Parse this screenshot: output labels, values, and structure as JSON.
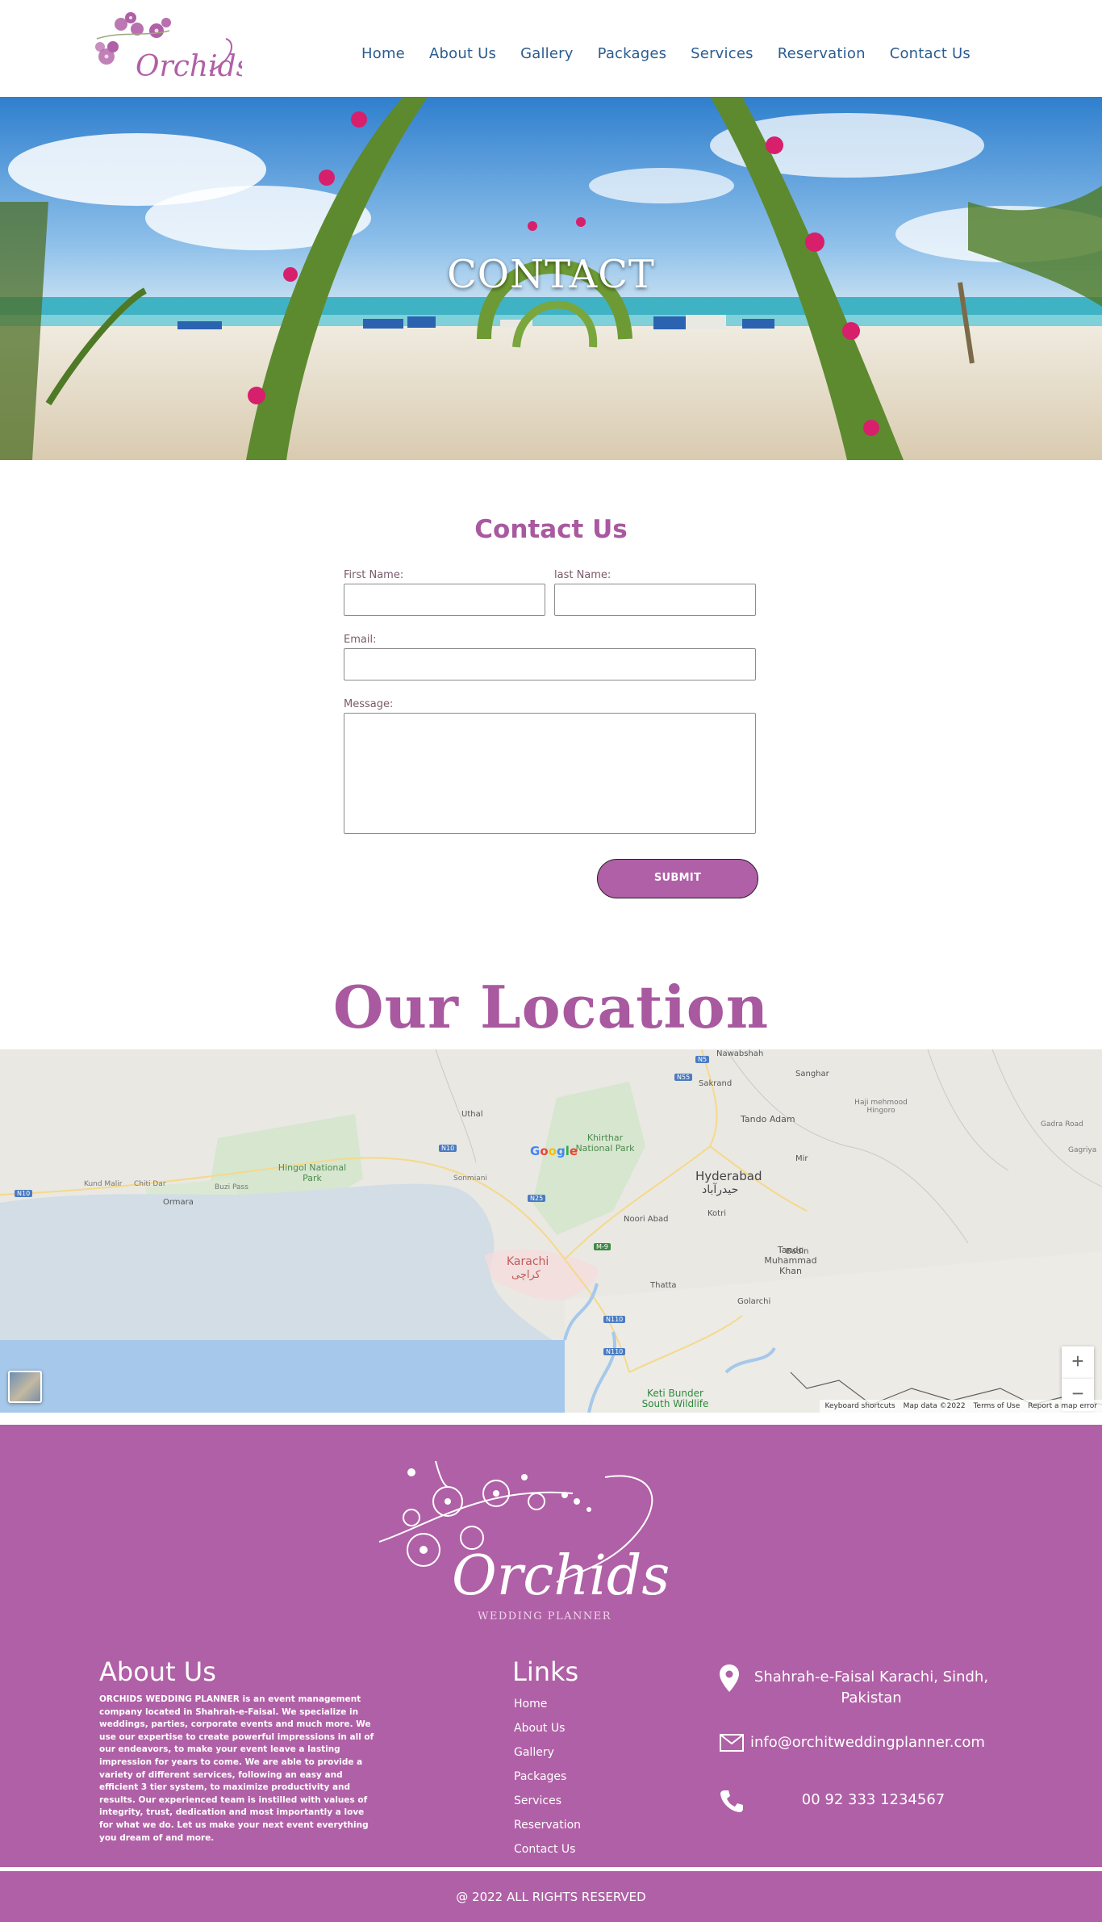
{
  "header": {
    "logo_text": "Orchids",
    "nav": [
      "Home",
      "About Us",
      "Gallery",
      "Packages",
      "Services",
      "Reservation",
      "Contact Us"
    ]
  },
  "hero": {
    "title": "CONTACT"
  },
  "contact_form": {
    "heading": "Contact Us",
    "first_name_label": "First Name:",
    "last_name_label": "last Name:",
    "email_label": "Email:",
    "message_label": "Message:",
    "submit_label": "SUBMIT"
  },
  "location": {
    "heading": "Our Location",
    "map_labels": {
      "karachi": "Karachi",
      "karachi_ur": "کراچی",
      "hyderabad": "Hyderabad",
      "hyderabad_ur": "حیدرآباد",
      "hingol": "Hingol National Park",
      "kirthar": "Khirthar National Park",
      "tando_adam": "Tando Adam",
      "tando_muhammad_khan": "Tando Muhammad Khan",
      "thatta": "Thatta",
      "keti_bunder": "Keti Bunder South Wildlife",
      "ormara": "Ormara",
      "kotri": "Kotri",
      "noori_abad": "Noori Abad",
      "sakrand": "Sakrand",
      "sanghar": "Sanghar",
      "badin": "Badin",
      "golarchi": "Golarchi",
      "mir": "Mir",
      "hyb": "Haji mehmood Hingoro",
      "gadra": "Gadra Road",
      "khairpur": "Gagriya",
      "nawabshah": "Nawabshah",
      "sonmiani": "Sonmiani",
      "uthal": "Uthal",
      "buzi": "Buzi Pass",
      "kund": "Kund Malir",
      "chitidar": "Chiti Dar",
      "n10": "N10",
      "n25": "N25",
      "m9": "M-9",
      "n55": "N55",
      "n110": "N110",
      "n5": "N5"
    },
    "map_footer": [
      "Keyboard shortcuts",
      "Map data ©2022",
      "Terms of Use",
      "Report a map error"
    ],
    "zoom_in": "+",
    "zoom_out": "−",
    "attribution": "Google"
  },
  "footer": {
    "logo_text": "Orchids",
    "logo_sub": "WEDDING PLANNER",
    "about_heading": "About Us",
    "about_text": "ORCHIDS WEDDING PLANNER is an event management company located in Shahrah-e-Faisal. We specialize in weddings, parties, corporate events and much more. We use our expertise to create powerful impressions in all of our endeavors, to make your event leave a lasting impression for years to come. We are able to provide a variety of different services, following an easy and efficient 3 tier system, to maximize productivity and results. Our experienced team is instilled with values of integrity, trust, dedication and most importantly a love for what we do. Let us make your next event everything you dream of and more.",
    "links_heading": "Links",
    "links": [
      "Home",
      "About Us",
      "Gallery",
      "Packages",
      "Services",
      "Reservation",
      "Contact Us"
    ],
    "address": "Shahrah-e-Faisal Karachi, Sindh, Pakistan",
    "email": "info@orchitweddingplanner.com",
    "phone": "00 92 333 1234567",
    "copyright": "@ 2022 ALL RIGHTS RESERVED"
  },
  "colors": {
    "brand": "#b060a6",
    "nav_link": "#2b5d92",
    "sea": "#a4c9ea"
  }
}
